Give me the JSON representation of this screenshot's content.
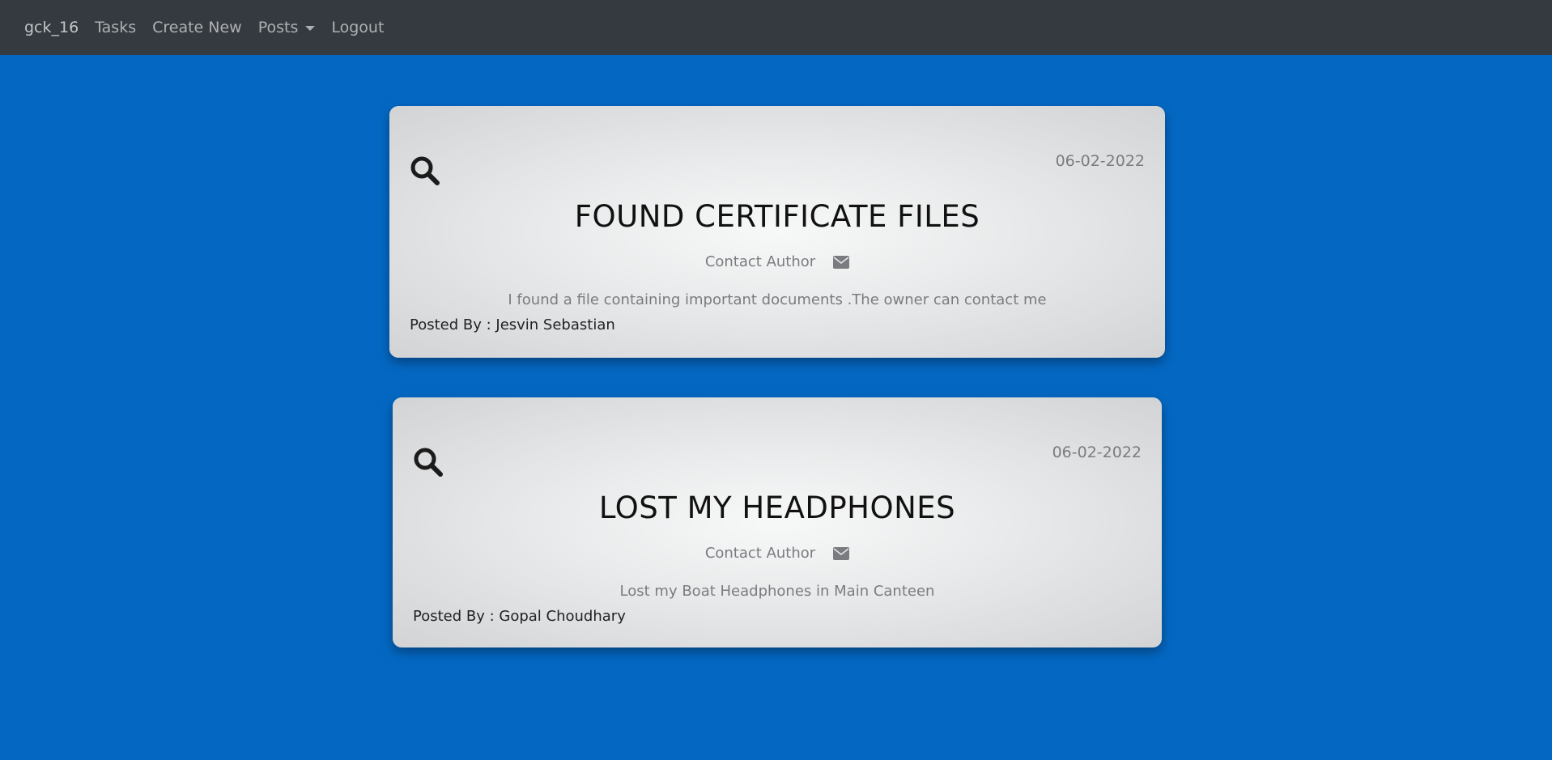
{
  "nav": {
    "brand": "gck_16",
    "tasks": "Tasks",
    "create_new": "Create New",
    "posts": "Posts",
    "logout": "Logout"
  },
  "posts": [
    {
      "date": "06-02-2022",
      "title": "FOUND CERTIFICATE FILES",
      "contact_label": "Contact Author",
      "description": "I found a file containing important documents .The owner can contact me",
      "author": "Posted By : Jesvin Sebastian",
      "icon": "search-icon"
    },
    {
      "date": "06-02-2022",
      "title": "LOST MY HEADPHONES",
      "contact_label": "Contact Author",
      "description": "Lost my Boat Headphones in Main Canteen",
      "author": "Posted By : Gopal Choudhary",
      "icon": "search-icon"
    }
  ],
  "colors": {
    "background": "#0468c3",
    "navbar": "#343a40"
  }
}
